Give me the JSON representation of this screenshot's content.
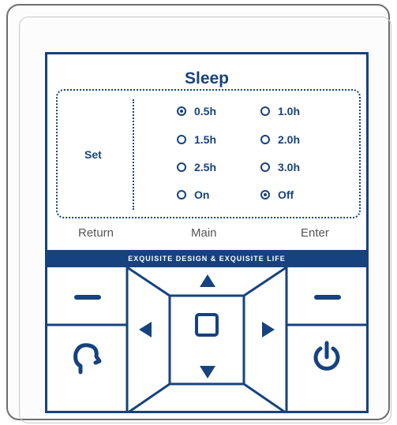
{
  "screen": {
    "title": "Sleep",
    "section_label": "Set",
    "options": [
      {
        "label": "0.5h",
        "selected": true
      },
      {
        "label": "1.0h",
        "selected": false
      },
      {
        "label": "1.5h",
        "selected": false
      },
      {
        "label": "2.0h",
        "selected": false
      },
      {
        "label": "2.5h",
        "selected": false
      },
      {
        "label": "3.0h",
        "selected": false
      },
      {
        "label": "On",
        "selected": false
      },
      {
        "label": "Off",
        "selected": true
      }
    ]
  },
  "footer": {
    "return_label": "Return",
    "main_label": "Main",
    "enter_label": "Enter"
  },
  "banner": {
    "text": "EXQUISITE DESIGN  &  EXQUISITE LIFE"
  },
  "colors": {
    "brand": "#16427f"
  },
  "icons": {
    "minus": "minus-icon",
    "back": "head-back-icon",
    "power": "power-icon",
    "up": "arrow-up-icon",
    "down": "arrow-down-icon",
    "left": "arrow-left-icon",
    "right": "arrow-right-icon",
    "center": "square-icon"
  }
}
